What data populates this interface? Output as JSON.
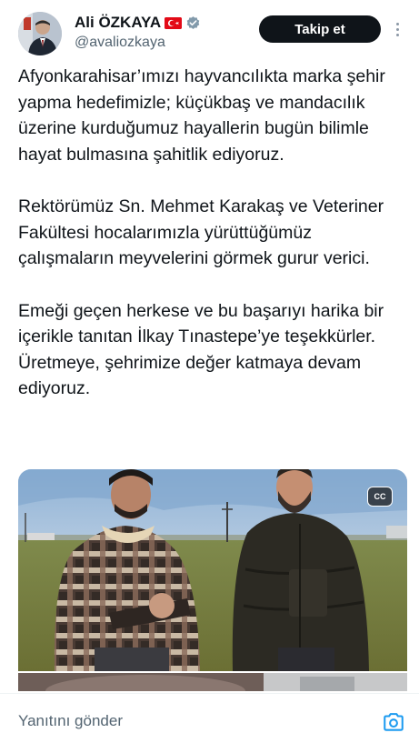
{
  "author": {
    "display_name": "Ali ÖZKAYA",
    "handle": "@avaliozkaya",
    "flag_icon": "turkey-flag-icon",
    "verified_icon": "verified-badge-icon"
  },
  "header": {
    "follow_label": "Takip et",
    "more_icon": "more-vertical-icon"
  },
  "tweet": {
    "paragraphs": [
      "Afyonkarahisar’ımızı hayvancılıkta marka şehir yapma hedefimizle; küçükbaş ve mandacılık üzerine kurduğumuz hayallerin bugün bilimle hayat bulmasına şahitlik ediyoruz.",
      "Rektörümüz Sn. Mehmet Karakaş ve Veteriner Fakültesi hocalarımızla yürüttüğümüz çalışmaların meyvelerini görmek gurur verici.",
      "Emeği geçen herkese ve bu başarıyı harika bir içerikle tanıtan İlkay Tınastepe’ye teşekkürler. Üretmeye, şehrimize değer katmaya devam ediyoruz."
    ]
  },
  "media": {
    "cc_label": "CC"
  },
  "reply": {
    "placeholder": "Yanıtını gönder",
    "camera_icon": "camera-icon"
  },
  "colors": {
    "text": "#0f1419",
    "secondary": "#536471",
    "accent": "#1d9bf0",
    "follow_bg": "#0f1419"
  }
}
